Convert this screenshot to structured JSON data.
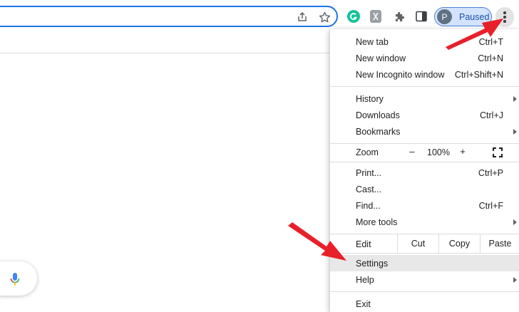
{
  "toolbar": {
    "profile_initial": "P",
    "profile_status": "Paused"
  },
  "menu": {
    "new_tab": {
      "label": "New tab",
      "shortcut": "Ctrl+T"
    },
    "new_window": {
      "label": "New window",
      "shortcut": "Ctrl+N"
    },
    "new_incognito": {
      "label": "New Incognito window",
      "shortcut": "Ctrl+Shift+N"
    },
    "history": {
      "label": "History"
    },
    "downloads": {
      "label": "Downloads",
      "shortcut": "Ctrl+J"
    },
    "bookmarks": {
      "label": "Bookmarks"
    },
    "zoom": {
      "label": "Zoom",
      "minus": "–",
      "value": "100%",
      "plus": "+"
    },
    "print": {
      "label": "Print...",
      "shortcut": "Ctrl+P"
    },
    "cast": {
      "label": "Cast..."
    },
    "find": {
      "label": "Find...",
      "shortcut": "Ctrl+F"
    },
    "more_tools": {
      "label": "More tools"
    },
    "edit": {
      "label": "Edit",
      "cut": "Cut",
      "copy": "Copy",
      "paste": "Paste"
    },
    "settings": {
      "label": "Settings"
    },
    "help": {
      "label": "Help"
    },
    "exit": {
      "label": "Exit"
    }
  },
  "colors": {
    "accent": "#1a73e8",
    "profile_chip_bg": "#d3e3fd",
    "annotation_arrow": "#e8202a"
  },
  "icons": [
    "share-icon",
    "bookmark-star-icon",
    "grammarly-icon",
    "extension-icon",
    "puzzle-icon",
    "side-panel-icon",
    "kebab-menu-icon",
    "mic-icon",
    "fullscreen-icon"
  ]
}
